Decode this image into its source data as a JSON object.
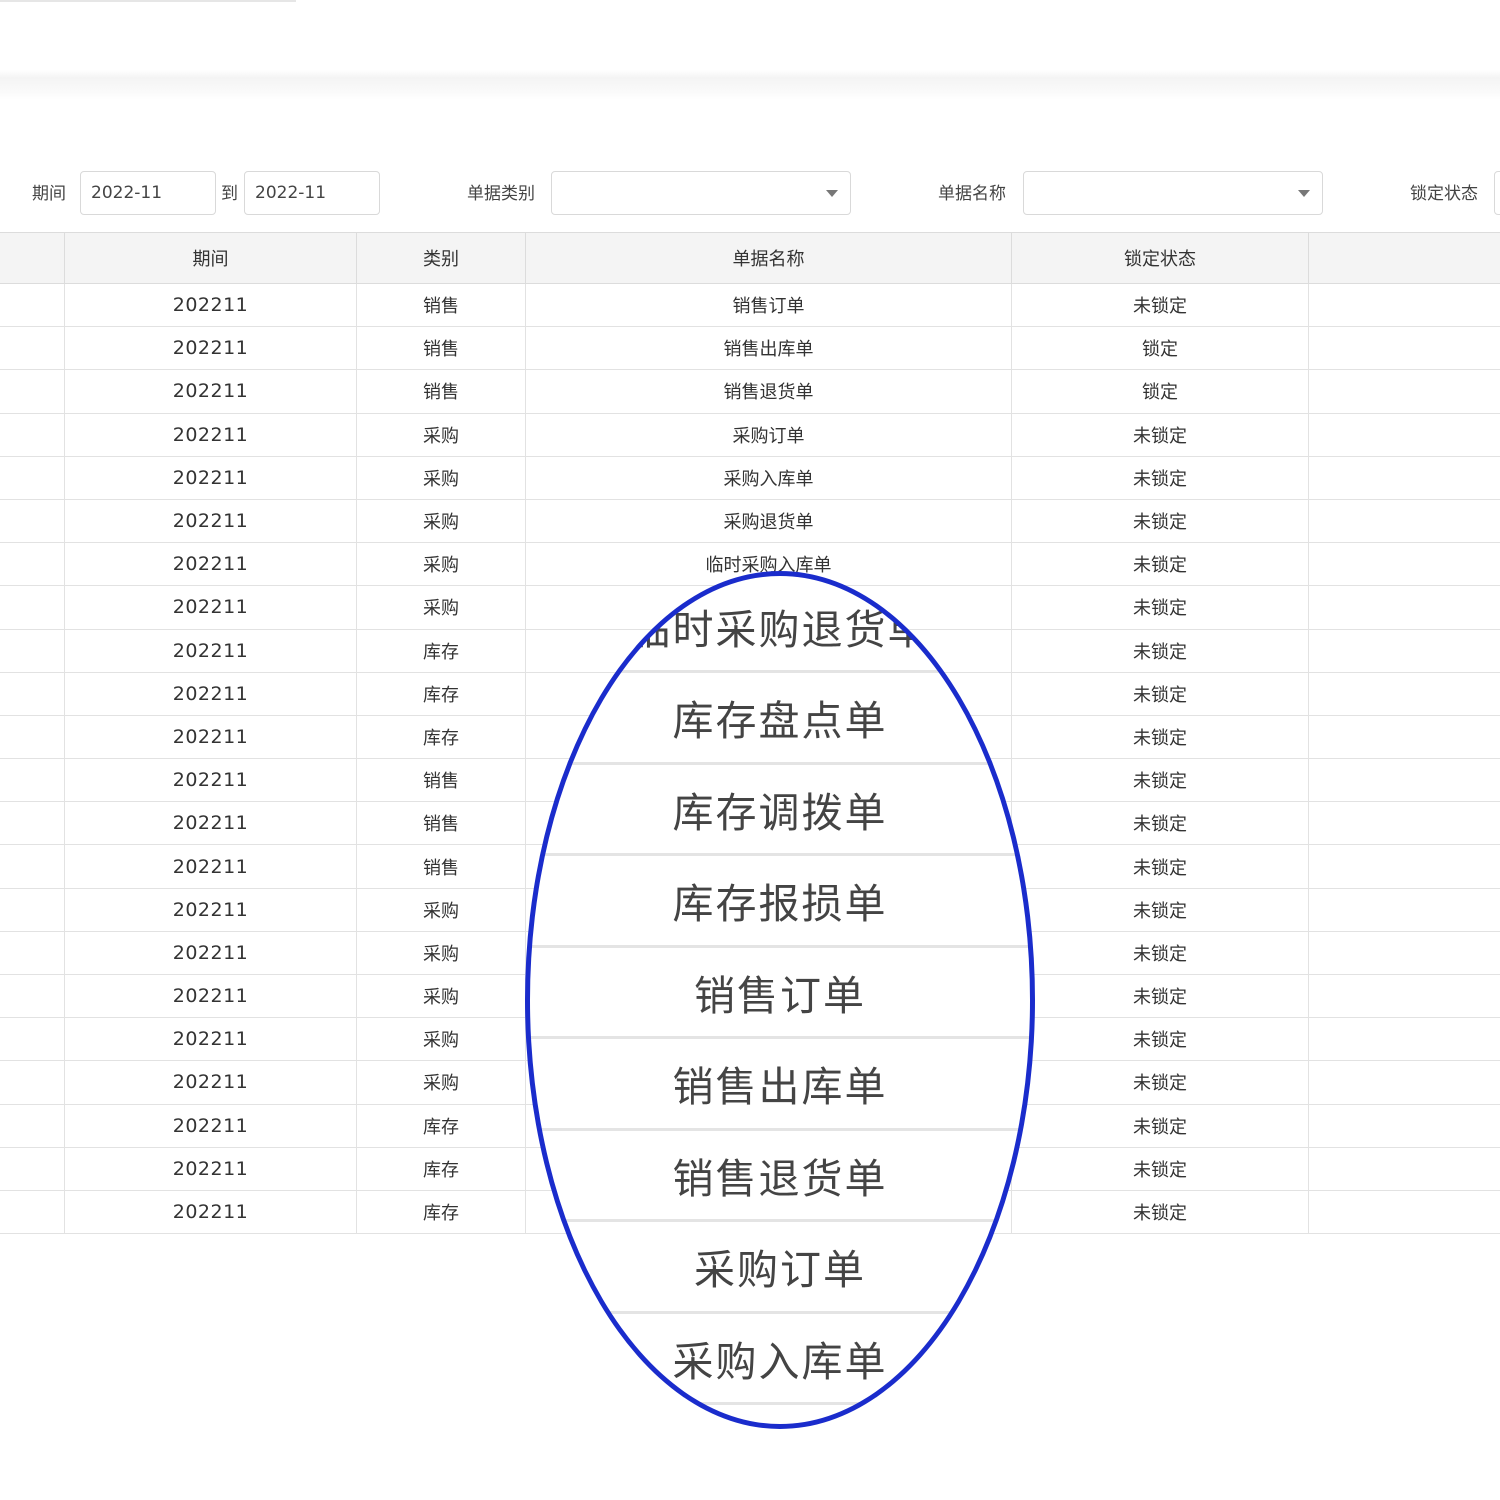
{
  "filters": {
    "period_label": "期间",
    "period_from": "2022-11",
    "period_to_label": "到",
    "period_to": "2022-11",
    "doc_type_label": "单据类别",
    "doc_type_value": "",
    "doc_name_label": "单据名称",
    "doc_name_value": "",
    "lock_status_label": "锁定状态"
  },
  "table": {
    "columns": [
      "期间",
      "类别",
      "单据名称",
      "锁定状态"
    ],
    "rows": [
      {
        "period": "202211",
        "category": "销售",
        "name": "销售订单",
        "status": "未锁定"
      },
      {
        "period": "202211",
        "category": "销售",
        "name": "销售出库单",
        "status": "锁定"
      },
      {
        "period": "202211",
        "category": "销售",
        "name": "销售退货单",
        "status": "锁定"
      },
      {
        "period": "202211",
        "category": "采购",
        "name": "采购订单",
        "status": "未锁定"
      },
      {
        "period": "202211",
        "category": "采购",
        "name": "采购入库单",
        "status": "未锁定"
      },
      {
        "period": "202211",
        "category": "采购",
        "name": "采购退货单",
        "status": "未锁定"
      },
      {
        "period": "202211",
        "category": "采购",
        "name": "临时采购入库单",
        "status": "未锁定"
      },
      {
        "period": "202211",
        "category": "采购",
        "name": "",
        "status": "未锁定"
      },
      {
        "period": "202211",
        "category": "库存",
        "name": "",
        "status": "未锁定"
      },
      {
        "period": "202211",
        "category": "库存",
        "name": "",
        "status": "未锁定"
      },
      {
        "period": "202211",
        "category": "库存",
        "name": "",
        "status": "未锁定"
      },
      {
        "period": "202211",
        "category": "销售",
        "name": "",
        "status": "未锁定"
      },
      {
        "period": "202211",
        "category": "销售",
        "name": "",
        "status": "未锁定"
      },
      {
        "period": "202211",
        "category": "销售",
        "name": "",
        "status": "未锁定"
      },
      {
        "period": "202211",
        "category": "采购",
        "name": "",
        "status": "未锁定"
      },
      {
        "period": "202211",
        "category": "采购",
        "name": "",
        "status": "未锁定"
      },
      {
        "period": "202211",
        "category": "采购",
        "name": "",
        "status": "未锁定"
      },
      {
        "period": "202211",
        "category": "采购",
        "name": "",
        "status": "未锁定"
      },
      {
        "period": "202211",
        "category": "采购",
        "name": "",
        "status": "未锁定"
      },
      {
        "period": "202211",
        "category": "库存",
        "name": "",
        "status": "未锁定"
      },
      {
        "period": "202211",
        "category": "库存",
        "name": "",
        "status": "未锁定"
      },
      {
        "period": "202211",
        "category": "库存",
        "name": "",
        "status": "未锁定"
      }
    ]
  },
  "zoom_callout": {
    "ring_color": "#1a2ccc",
    "items": [
      "临时采购退货单",
      "库存盘点单",
      "库存调拨单",
      "库存报损单",
      "销售订单",
      "销售出库单",
      "销售退货单",
      "采购订单",
      "采购入库单"
    ]
  }
}
